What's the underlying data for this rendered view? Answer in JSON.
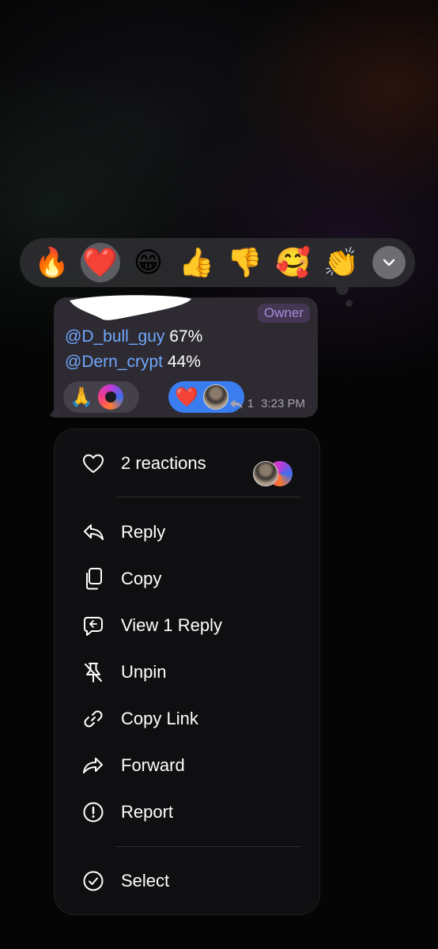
{
  "reaction_bar": {
    "emojis": [
      "🔥",
      "❤️",
      "😁",
      "👍",
      "👎",
      "🥰",
      "👏"
    ],
    "selected_index": 1,
    "expand_icon": "chevron-down-icon"
  },
  "message": {
    "owner_badge": "Owner",
    "line1_handle": "@D_bull_guy",
    "line1_value": "67%",
    "line2_handle": "@Dern_crypt",
    "line2_value": "44%",
    "reaction_chip_1_emoji": "🙏",
    "reaction_chip_2_emoji": "❤️",
    "reply_count": "1",
    "time": "3:23 PM"
  },
  "menu": {
    "reactions_label": "2 reactions",
    "items": [
      {
        "label": "Reply",
        "icon": "reply-icon"
      },
      {
        "label": "Copy",
        "icon": "copy-icon"
      },
      {
        "label": "View 1 Reply",
        "icon": "view-replies-icon"
      },
      {
        "label": "Unpin",
        "icon": "unpin-icon"
      },
      {
        "label": "Copy Link",
        "icon": "link-icon"
      },
      {
        "label": "Forward",
        "icon": "forward-icon"
      },
      {
        "label": "Report",
        "icon": "report-icon"
      }
    ],
    "select_label": "Select"
  },
  "colors": {
    "accent_blue": "#3a7df0",
    "mention_blue": "#6fa8ff",
    "owner_purple": "#a98bd8"
  }
}
